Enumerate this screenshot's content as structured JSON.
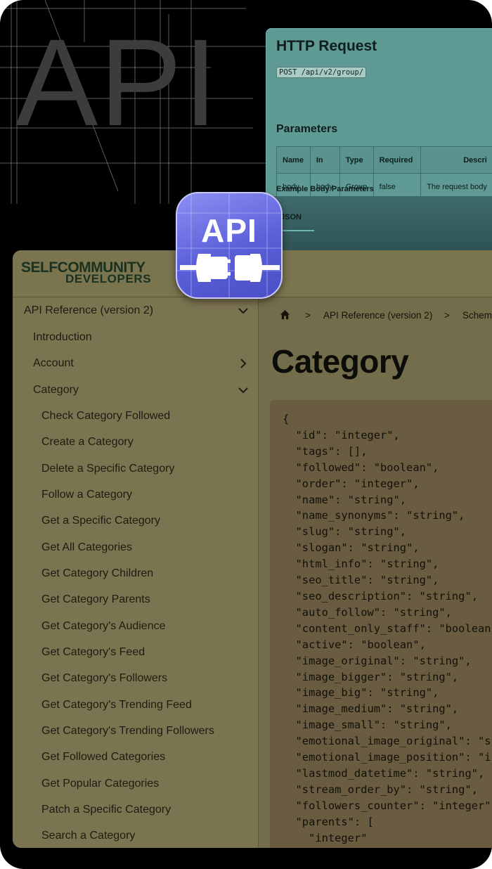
{
  "hero": {
    "word": "API"
  },
  "http_request": {
    "title": "HTTP Request",
    "endpoint": "POST /api/v2/group/",
    "parameters_title": "Parameters",
    "columns": [
      "Name",
      "In",
      "Type",
      "Required",
      "Descri"
    ],
    "row": [
      "body",
      "body",
      "Group",
      "false",
      "The request body"
    ],
    "example_label": "Example Body Parameters",
    "tab_json": "JSON"
  },
  "app_icon": {
    "label": "API",
    "icon": "plug-icon"
  },
  "logo": {
    "line1": "SELFCOMMUNITY",
    "line2": "DEVELOPERS"
  },
  "sidebar": {
    "section": "API Reference (version 2)",
    "items": [
      {
        "label": "Introduction",
        "level": 1
      },
      {
        "label": "Account",
        "level": 1,
        "chevron": "right"
      },
      {
        "label": "Category",
        "level": 1,
        "chevron": "down"
      },
      {
        "label": "Check Category Followed",
        "level": 2
      },
      {
        "label": "Create a Category",
        "level": 2
      },
      {
        "label": "Delete a Specific Category",
        "level": 2
      },
      {
        "label": "Follow a Category",
        "level": 2
      },
      {
        "label": "Get a Specific Category",
        "level": 2
      },
      {
        "label": "Get All Categories",
        "level": 2
      },
      {
        "label": "Get Category Children",
        "level": 2
      },
      {
        "label": "Get Category Parents",
        "level": 2
      },
      {
        "label": "Get Category's Audience",
        "level": 2
      },
      {
        "label": "Get Category's Feed",
        "level": 2
      },
      {
        "label": "Get Category's Followers",
        "level": 2
      },
      {
        "label": "Get Category's Trending Feed",
        "level": 2
      },
      {
        "label": "Get Category's Trending Followers",
        "level": 2
      },
      {
        "label": "Get Followed Categories",
        "level": 2
      },
      {
        "label": "Get Popular Categories",
        "level": 2
      },
      {
        "label": "Patch a Specific Category",
        "level": 2
      },
      {
        "label": "Search a Category",
        "level": 2
      }
    ]
  },
  "breadcrumb": {
    "items": [
      "API Reference (version 2)",
      "Schem"
    ],
    "separator": ">"
  },
  "page": {
    "title": "Category"
  },
  "code": {
    "lines": [
      "{",
      "  \"id\": \"integer\",",
      "  \"tags\": [],",
      "  \"followed\": \"boolean\",",
      "  \"order\": \"integer\",",
      "  \"name\": \"string\",",
      "  \"name_synonyms\": \"string\",",
      "  \"slug\": \"string\",",
      "  \"slogan\": \"string\",",
      "  \"html_info\": \"string\",",
      "  \"seo_title\": \"string\",",
      "  \"seo_description\": \"string\",",
      "  \"auto_follow\": \"string\",",
      "  \"content_only_staff\": \"boolean\",",
      "  \"active\": \"boolean\",",
      "  \"image_original\": \"string\",",
      "  \"image_bigger\": \"string\",",
      "  \"image_big\": \"string\",",
      "  \"image_medium\": \"string\",",
      "  \"image_small\": \"string\",",
      "  \"emotional_image_original\": \"string\",",
      "  \"emotional_image_position\": \"integer\",",
      "  \"lastmod_datetime\": \"string\",",
      "  \"stream_order_by\": \"string\",",
      "  \"followers_counter\": \"integer\",",
      "  \"parents\": [",
      "    \"integer\""
    ]
  },
  "colors": {
    "frame": "#000000",
    "http_card": "#5f9a94",
    "portal": "#756e4c",
    "code_block": "#6a5c41",
    "app_icon": "#5a5fd8"
  }
}
